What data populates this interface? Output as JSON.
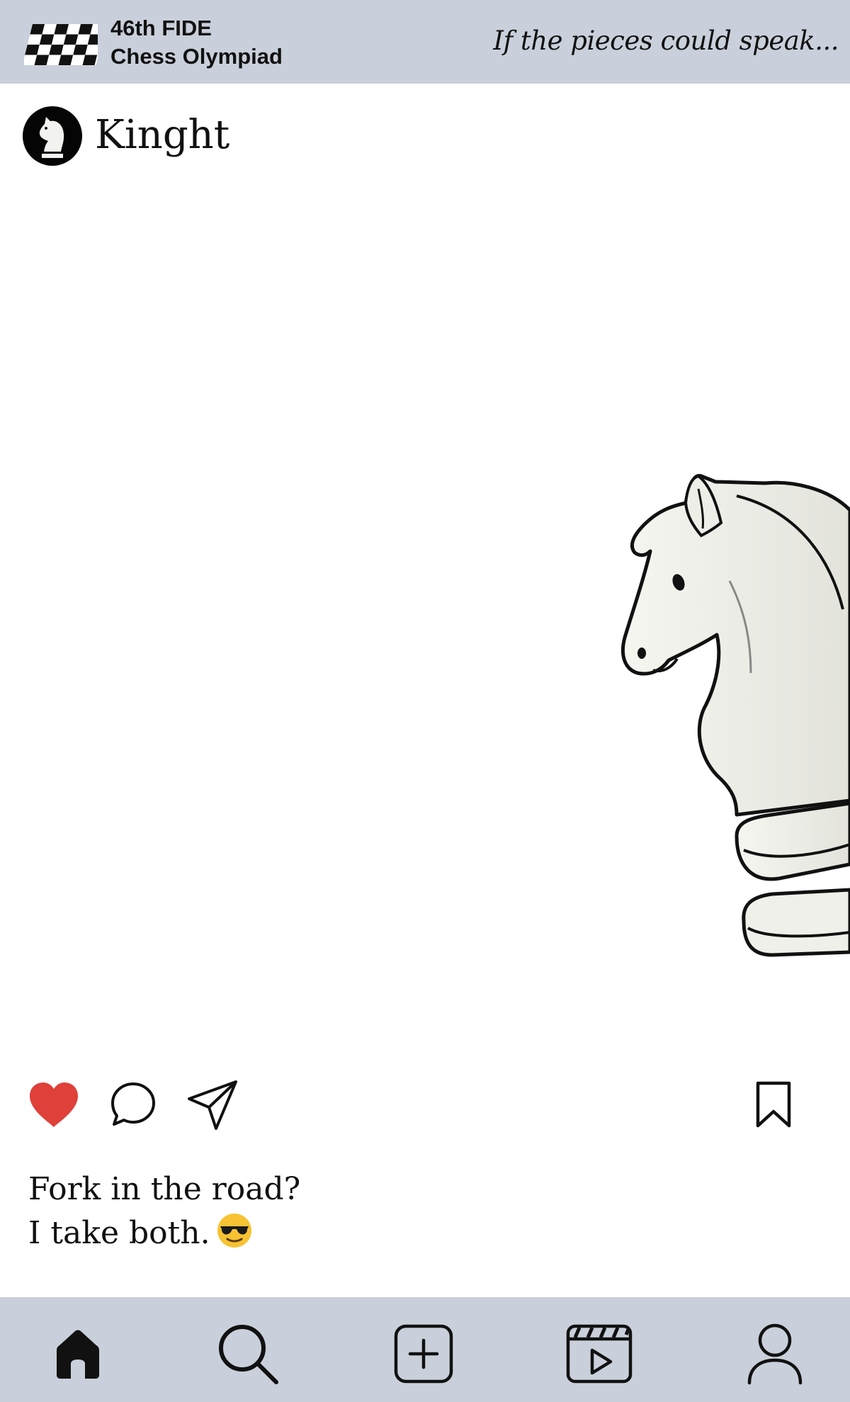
{
  "header": {
    "event_line1": "46th FIDE",
    "event_line2": "Chess Olympiad",
    "tagline": "If the pieces could speak...",
    "flag_icon": "checkered-flag-icon",
    "background": "#c9d0db"
  },
  "post": {
    "username": "Kinght",
    "avatar_icon": "white-knight-avatar",
    "image": "white-knight-illustration",
    "caption_line1": "Fork in the road?",
    "caption_line2": "I take both.",
    "caption_emoji": "smiling-face-with-sunglasses",
    "liked": true,
    "like_color": "#e0403a"
  },
  "actions": {
    "like": "heart-icon",
    "comment": "comment-icon",
    "share": "send-icon",
    "save": "bookmark-icon"
  },
  "nav": {
    "items": [
      {
        "id": "home",
        "icon": "home-icon",
        "active": true
      },
      {
        "id": "search",
        "icon": "search-icon"
      },
      {
        "id": "create",
        "icon": "add-post-icon"
      },
      {
        "id": "reels",
        "icon": "reels-icon"
      },
      {
        "id": "profile",
        "icon": "profile-icon"
      }
    ],
    "background": "#c9d0db"
  }
}
